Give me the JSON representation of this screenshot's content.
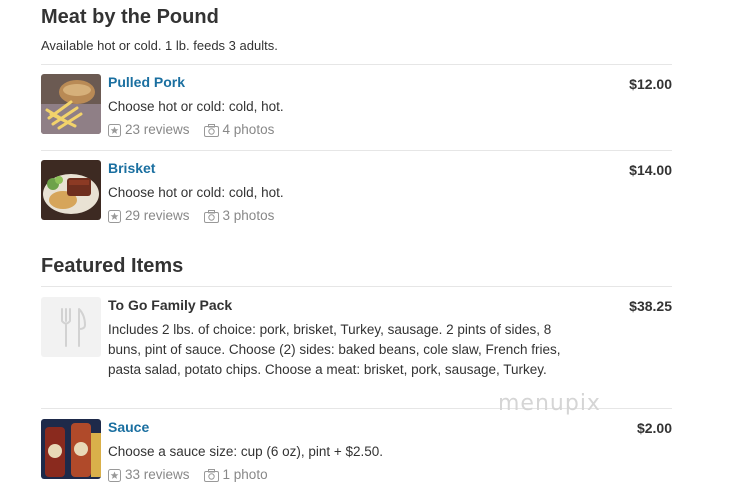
{
  "sections": [
    {
      "title": "Meat by the Pound",
      "description": "Available hot or cold. 1 lb. feeds 3 adults.",
      "items": [
        {
          "name": "Pulled Pork",
          "price": "$12.00",
          "description": "Choose hot or cold: cold, hot.",
          "reviews": "23 reviews",
          "photos": "4 photos",
          "thumb": "fries-photo"
        },
        {
          "name": "Brisket",
          "price": "$14.00",
          "description": "Choose hot or cold: cold, hot.",
          "reviews": "29 reviews",
          "photos": "3 photos",
          "thumb": "brisket-photo"
        }
      ]
    },
    {
      "title": "Featured Items",
      "items": [
        {
          "name": "To Go Family Pack",
          "price": "$38.25",
          "description": "Includes 2 lbs. of choice: pork, brisket, Turkey, sausage. 2 pints of sides, 8 buns, pint of sauce. Choose (2) sides: baked beans, cole slaw, French fries, pasta salad, potato chips. Choose a meat: brisket, pork, sausage, Turkey.",
          "thumb": "utensils-placeholder"
        },
        {
          "name": "Sauce",
          "price": "$2.00",
          "description": "Choose a sauce size: cup (6 oz), pint + $2.50.",
          "reviews": "33 reviews",
          "photos": "1 photo",
          "thumb": "sauce-bottles-photo"
        }
      ]
    }
  ],
  "watermark": "menupix",
  "icons": {
    "review": "star-box-icon",
    "photo": "camera-icon",
    "placeholder": "fork-knife-icon"
  },
  "colors": {
    "link": "#1a6fa0",
    "meta": "#888888",
    "divider": "#e6e6e6"
  }
}
